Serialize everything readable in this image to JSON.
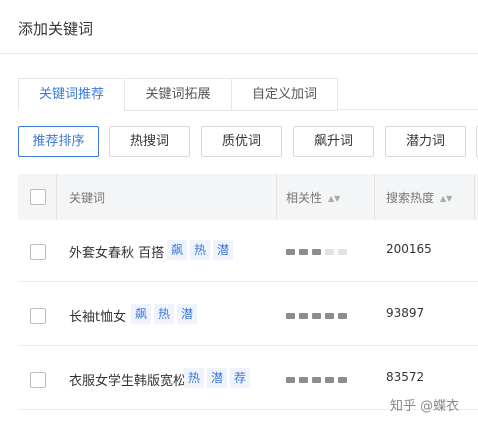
{
  "header": {
    "title": "添加关键词"
  },
  "tabs": [
    {
      "label": "关键词推荐",
      "active": true
    },
    {
      "label": "关键词拓展",
      "active": false
    },
    {
      "label": "自定义加词",
      "active": false
    }
  ],
  "filters": [
    {
      "label": "推荐排序",
      "active": true
    },
    {
      "label": "热搜词",
      "active": false
    },
    {
      "label": "质优词",
      "active": false
    },
    {
      "label": "飙升词",
      "active": false
    },
    {
      "label": "潜力词",
      "active": false
    }
  ],
  "table": {
    "columns": {
      "keyword": "关键词",
      "relevance": "相关性",
      "heat": "搜索热度"
    },
    "sort_icon": "sort-icon",
    "rows": [
      {
        "keyword": "外套女春秋 百搭",
        "tags": [
          "飙",
          "热",
          "潜"
        ],
        "relevance_level": 3,
        "relevance_max": 5,
        "heat": "200165"
      },
      {
        "keyword": "长袖t恤女",
        "tags": [
          "飙",
          "热",
          "潜"
        ],
        "relevance_level": 5,
        "relevance_max": 5,
        "heat": "93897"
      },
      {
        "keyword": "衣服女学生韩版宽松",
        "tags": [
          "热",
          "潜",
          "荐"
        ],
        "relevance_level": 5,
        "relevance_max": 5,
        "heat": "83572"
      }
    ]
  },
  "watermark": "知乎 @蝶衣",
  "colors": {
    "accent": "#3b79d8",
    "tag_bg": "#eef3fc",
    "header_bg": "#f4f5f7"
  }
}
